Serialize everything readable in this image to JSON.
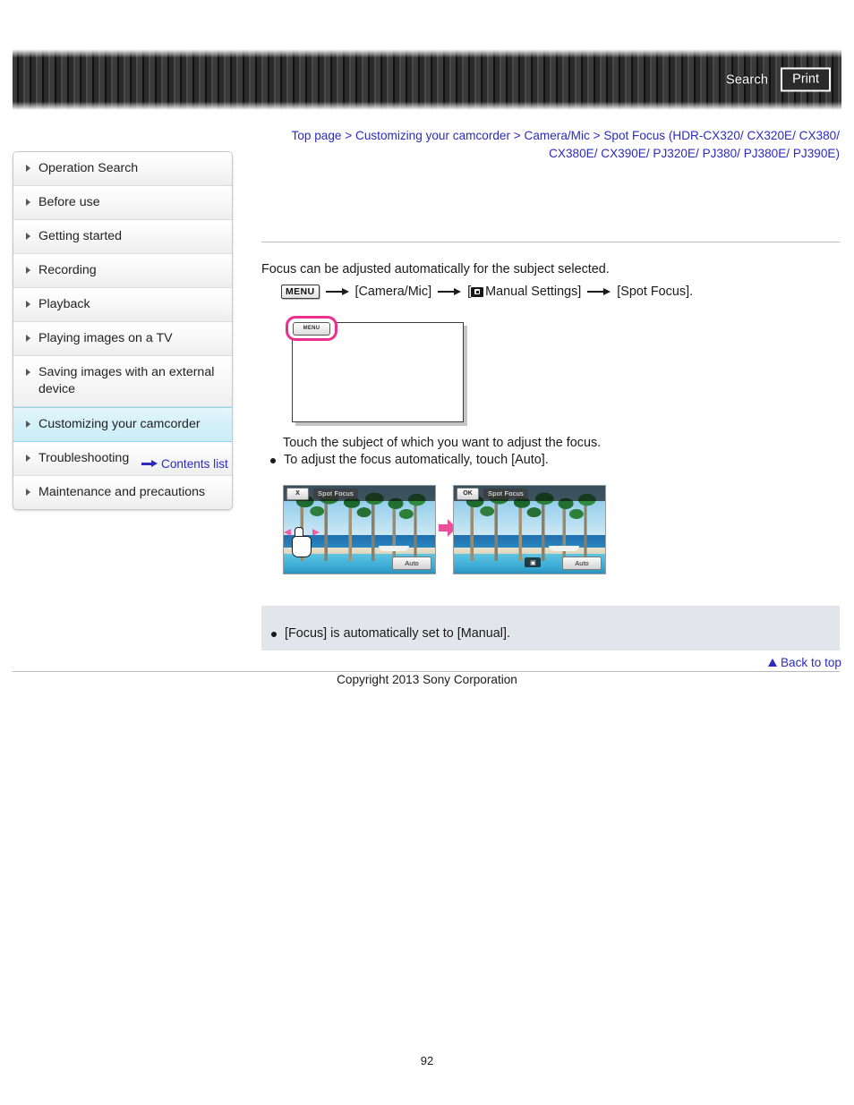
{
  "header": {
    "search_label": "Search",
    "print_label": "Print"
  },
  "breadcrumb": {
    "items": [
      "Top page",
      "Customizing your camcorder",
      "Camera/Mic",
      "Spot Focus (HDR-CX320/ CX320E/ CX380/ CX380E/ CX390E/ PJ320E/ PJ380/ PJ380E/ PJ390E)"
    ],
    "separator": ">"
  },
  "sidebar": {
    "items": [
      {
        "label": "Operation Search",
        "selected": false
      },
      {
        "label": "Before use",
        "selected": false
      },
      {
        "label": "Getting started",
        "selected": false
      },
      {
        "label": "Recording",
        "selected": false
      },
      {
        "label": "Playback",
        "selected": false
      },
      {
        "label": "Playing images on a TV",
        "selected": false
      },
      {
        "label": "Saving images with an external device",
        "selected": false
      },
      {
        "label": "Customizing your camcorder",
        "selected": true
      },
      {
        "label": "Troubleshooting",
        "selected": false
      },
      {
        "label": "Maintenance and precautions",
        "selected": false
      }
    ],
    "contents_list_label": "Contents list"
  },
  "main": {
    "intro": "Focus can be adjusted automatically for the subject selected.",
    "menu_path": {
      "menu_chip": "MENU",
      "step1": "[Camera/Mic]",
      "step2_prefix": "[",
      "step2": "Manual Settings]",
      "step3": "[Spot Focus]."
    },
    "lcd_figure": {
      "menu_button_label": "MENU"
    },
    "step2_instruction": "Touch the subject of which you want to adjust the focus.",
    "step2_bullet": "To adjust the focus automatically, touch [Auto].",
    "photos": {
      "left": {
        "close_label": "X",
        "title": "Spot Focus",
        "auto_label": "Auto"
      },
      "right": {
        "ok_label": "OK",
        "title": "Spot Focus",
        "auto_label": "Auto",
        "focus_marker": "▣"
      }
    },
    "note": "[Focus] is automatically set to [Manual]."
  },
  "footer": {
    "back_to_top": "Back to top",
    "copyright": "Copyright 2013 Sony Corporation",
    "page_number": "92"
  },
  "colors": {
    "link": "#2b2bbf",
    "selected_nav": "#cdeef7",
    "highlight_pink": "#ec2f8f",
    "note_bg": "#e2e5ea"
  }
}
